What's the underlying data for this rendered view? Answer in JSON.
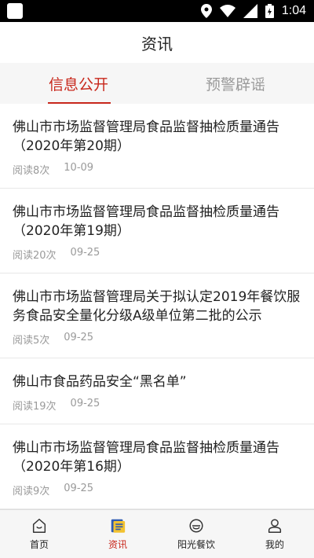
{
  "status_bar": {
    "time": "1:04"
  },
  "header": {
    "title": "资讯"
  },
  "tabs": [
    {
      "label": "信息公开",
      "active": true
    },
    {
      "label": "预警辟谣",
      "active": false
    }
  ],
  "articles": [
    {
      "title": "佛山市市场监督管理局食品监督抽检质量通告（2020年第20期）",
      "reads": "阅读8次",
      "date": "10-09"
    },
    {
      "title": "佛山市市场监督管理局食品监督抽检质量通告（2020年第19期）",
      "reads": "阅读20次",
      "date": "09-25"
    },
    {
      "title": "佛山市市场监督管理局关于拟认定2019年餐饮服务食品安全量化分级A级单位第二批的公示",
      "reads": "阅读5次",
      "date": "09-25"
    },
    {
      "title": "佛山市食品药品安全“黑名单”",
      "reads": "阅读19次",
      "date": "09-25"
    },
    {
      "title": "佛山市市场监督管理局食品监督抽检质量通告（2020年第16期）",
      "reads": "阅读9次",
      "date": "09-25"
    }
  ],
  "bottom_nav": [
    {
      "label": "首页",
      "icon": "home-icon",
      "active": false
    },
    {
      "label": "资讯",
      "icon": "news-icon",
      "active": true
    },
    {
      "label": "阳光餐饮",
      "icon": "dining-icon",
      "active": false
    },
    {
      "label": "我的",
      "icon": "user-icon",
      "active": false
    }
  ],
  "colors": {
    "accent": "#c8271b",
    "status_bar": "#000000",
    "tab_bg": "#f6f6f6"
  }
}
